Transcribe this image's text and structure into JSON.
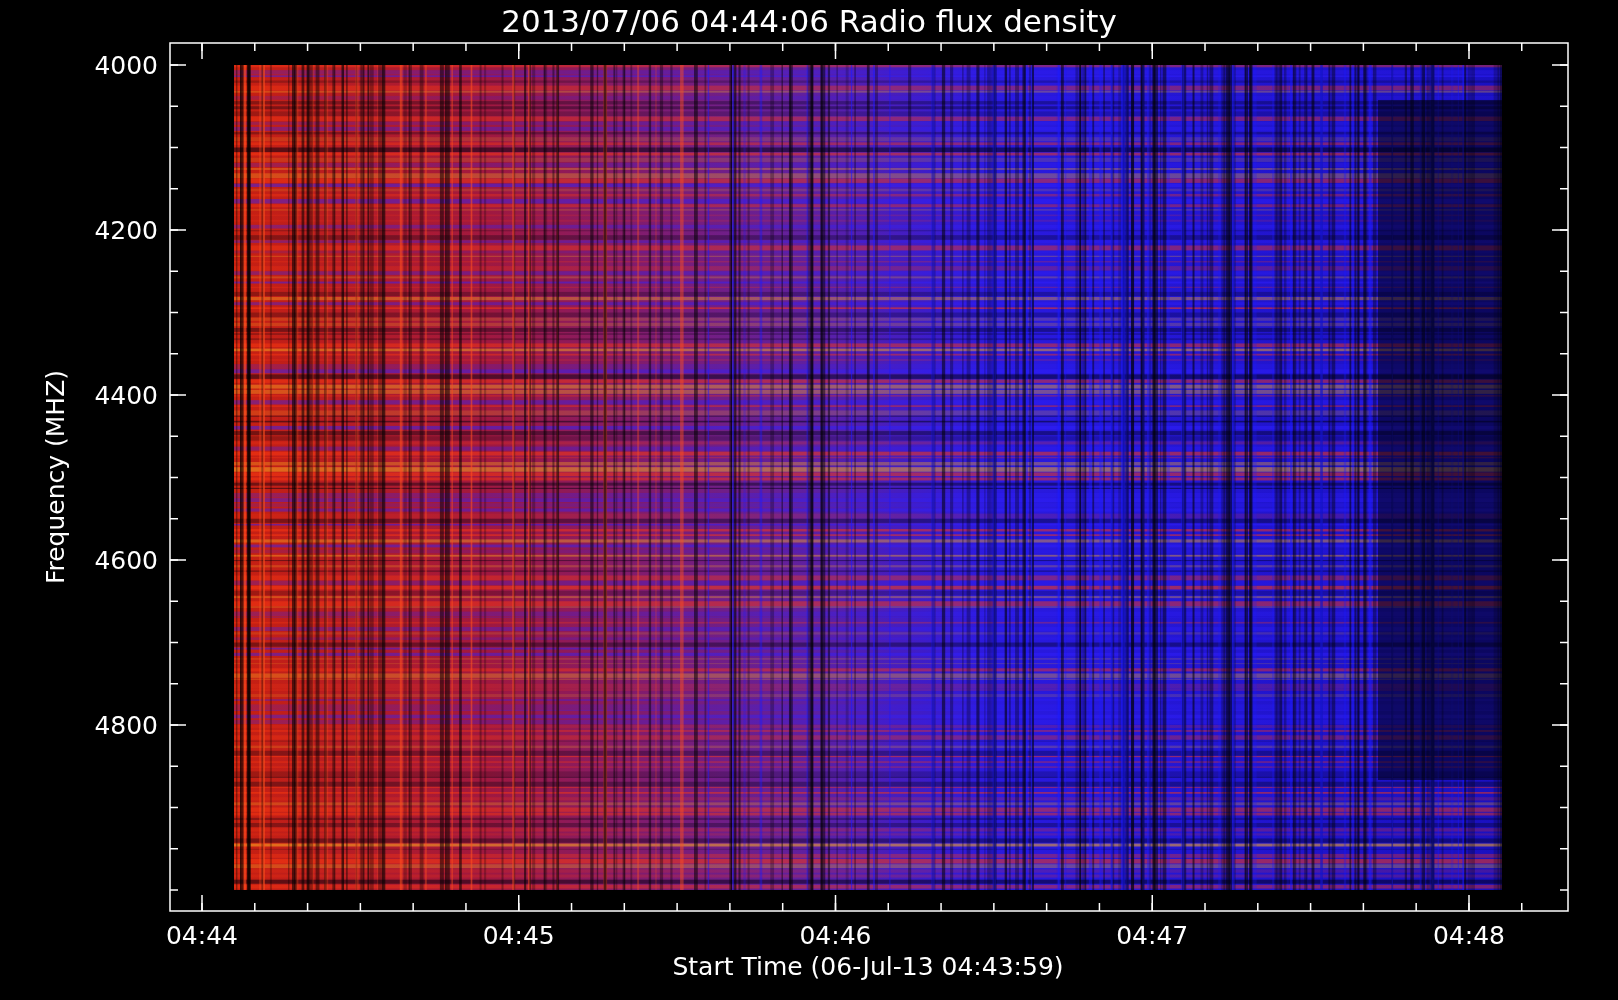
{
  "title": "2013/07/06 04:44:06 Radio flux density",
  "y_axis": {
    "label": "Frequency (MHZ)",
    "ticks": [
      "4000",
      "4200",
      "4400",
      "4600",
      "4800"
    ]
  },
  "x_axis": {
    "label": "Start Time (06-Jul-13 04:43:59)",
    "ticks": [
      "04:44",
      "04:45",
      "04:46",
      "04:47",
      "04:48"
    ]
  }
}
